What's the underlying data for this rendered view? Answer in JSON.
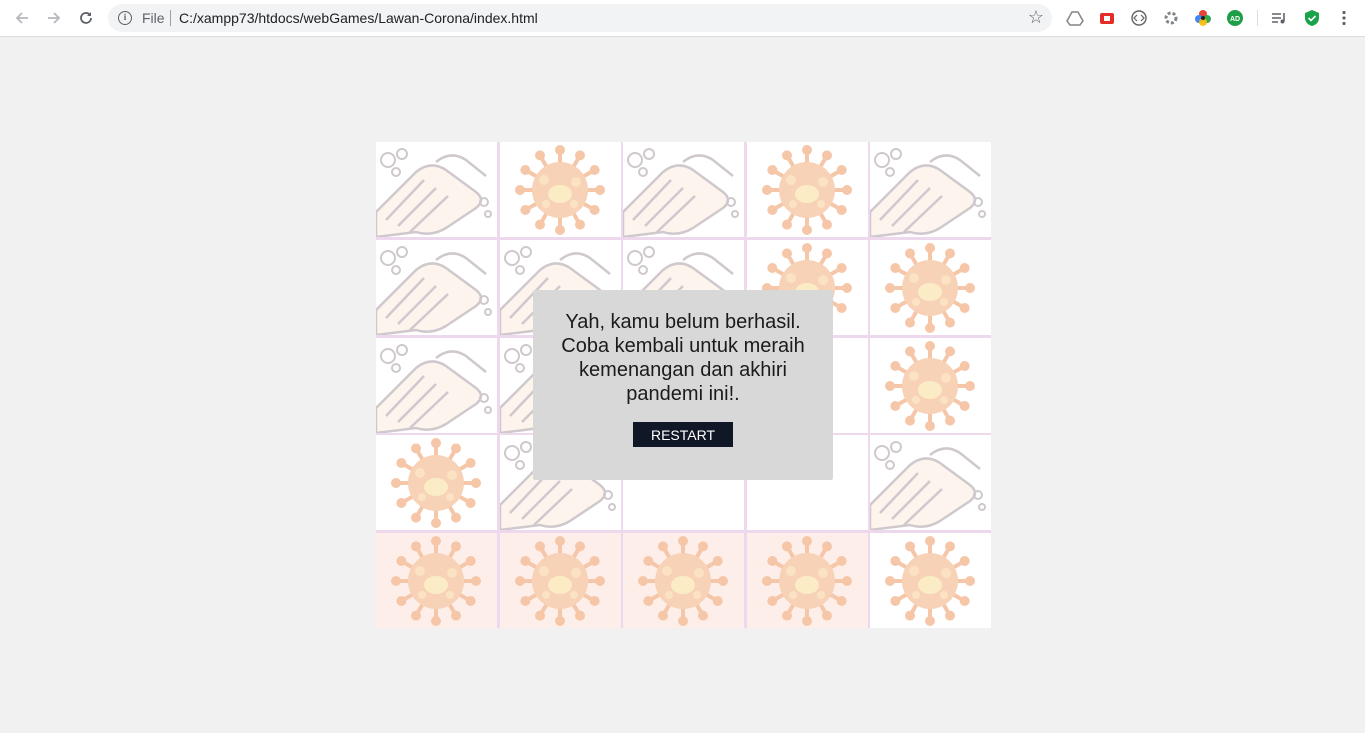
{
  "browser": {
    "scheme_label": "File",
    "url": "C:/xampp73/htdocs/webGames/Lawan-Corona/index.html",
    "extensions": [
      "drive-icon",
      "save-icon",
      "code-icon",
      "gear-icon",
      "color-wheel-icon",
      "adguard-icon",
      "media-icon",
      "shield-icon"
    ]
  },
  "board": {
    "tiles": [
      {
        "kind": "hands",
        "bg": "white"
      },
      {
        "kind": "virus",
        "bg": "white"
      },
      {
        "kind": "hands",
        "bg": "white"
      },
      {
        "kind": "virus",
        "bg": "white"
      },
      {
        "kind": "hands",
        "bg": "white"
      },
      {
        "kind": "hands",
        "bg": "white"
      },
      {
        "kind": "hands",
        "bg": "white"
      },
      {
        "kind": "hands",
        "bg": "white"
      },
      {
        "kind": "virus",
        "bg": "white"
      },
      {
        "kind": "virus",
        "bg": "white"
      },
      {
        "kind": "hands",
        "bg": "white"
      },
      {
        "kind": "hands",
        "bg": "white"
      },
      {
        "kind": "blank",
        "bg": "white"
      },
      {
        "kind": "blank",
        "bg": "white"
      },
      {
        "kind": "virus",
        "bg": "white"
      },
      {
        "kind": "virus",
        "bg": "white"
      },
      {
        "kind": "hands",
        "bg": "white"
      },
      {
        "kind": "blank",
        "bg": "white"
      },
      {
        "kind": "blank",
        "bg": "white"
      },
      {
        "kind": "hands",
        "bg": "white"
      },
      {
        "kind": "virus",
        "bg": "pink"
      },
      {
        "kind": "virus",
        "bg": "pink"
      },
      {
        "kind": "virus",
        "bg": "pink"
      },
      {
        "kind": "virus",
        "bg": "pink"
      },
      {
        "kind": "virus",
        "bg": "white"
      }
    ]
  },
  "modal": {
    "message": "Yah, kamu belum berhasil. Coba kembali untuk meraih kemenangan dan akhiri pandemi ini!.",
    "restart_label": "RESTART"
  },
  "colors": {
    "modal_bg": "#d8d8d8",
    "button_bg": "#101827",
    "page_bg": "#f1f1f1"
  }
}
